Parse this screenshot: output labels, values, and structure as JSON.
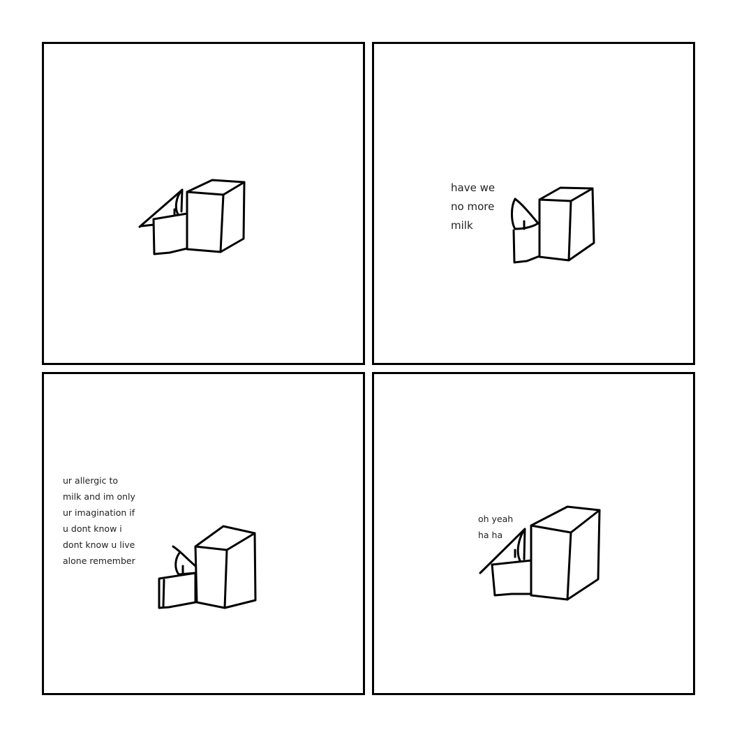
{
  "comic": {
    "panels": [
      {
        "id": "panel-1",
        "caption_lines": []
      },
      {
        "id": "panel-2",
        "caption_lines": [
          "have we",
          "no more",
          "milk"
        ]
      },
      {
        "id": "panel-3",
        "caption_lines": [
          "ur allergic to",
          "milk and im only",
          "ur imagination if",
          "u dont know i",
          "dont know u live",
          "alone remember"
        ]
      },
      {
        "id": "panel-4",
        "caption_lines": [
          "oh yeah",
          "ha ha"
        ]
      }
    ]
  },
  "colors": {
    "ink": "#000000",
    "text": "#222222",
    "background": "#ffffff"
  },
  "icons": [
    "character-drawing",
    "box-drawing"
  ]
}
